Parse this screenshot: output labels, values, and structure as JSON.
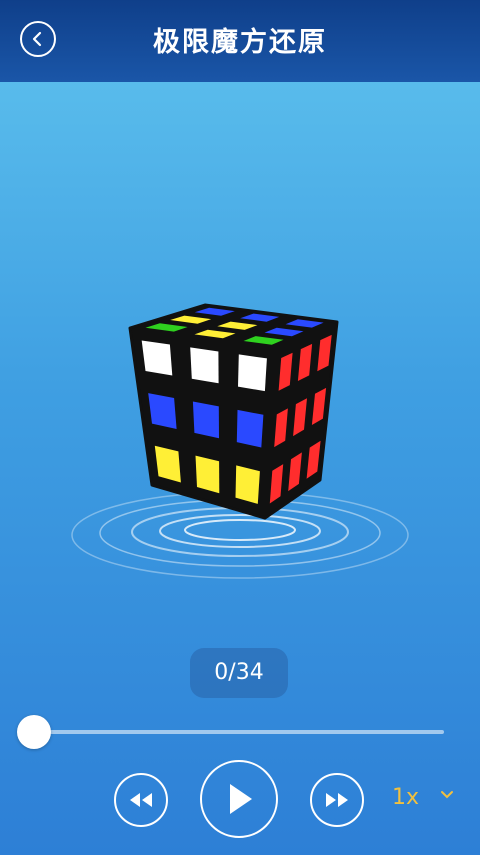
{
  "header": {
    "title": "极限魔方还原",
    "back_icon": "back-arrow-icon"
  },
  "player": {
    "step_counter": "0/34",
    "current_step": 0,
    "total_steps": 34,
    "progress": 0,
    "speed_label": "1x",
    "controls": [
      "rewind-icon",
      "play-icon",
      "fast-forward-icon"
    ]
  },
  "cube": {
    "top_face": [
      [
        "blue",
        "blue",
        "blue"
      ],
      [
        "yellow",
        "yellow",
        "blue"
      ],
      [
        "green",
        "yellow",
        "green"
      ]
    ],
    "front_face": [
      [
        "white",
        "white",
        "white"
      ],
      [
        "blue",
        "blue",
        "blue"
      ],
      [
        "yellow",
        "yellow",
        "yellow"
      ]
    ],
    "right_face": [
      [
        "red",
        "red",
        "red"
      ],
      [
        "red",
        "red",
        "red"
      ],
      [
        "red",
        "red",
        "red"
      ]
    ]
  },
  "colors": {
    "header_bg": "#0f3f8a",
    "accent_speed": "#f0c040",
    "cube_white": "#ffffff",
    "cube_blue": "#2a49ff",
    "cube_yellow": "#ffef36",
    "cube_green": "#2fd11f",
    "cube_red": "#ff2d2d"
  }
}
